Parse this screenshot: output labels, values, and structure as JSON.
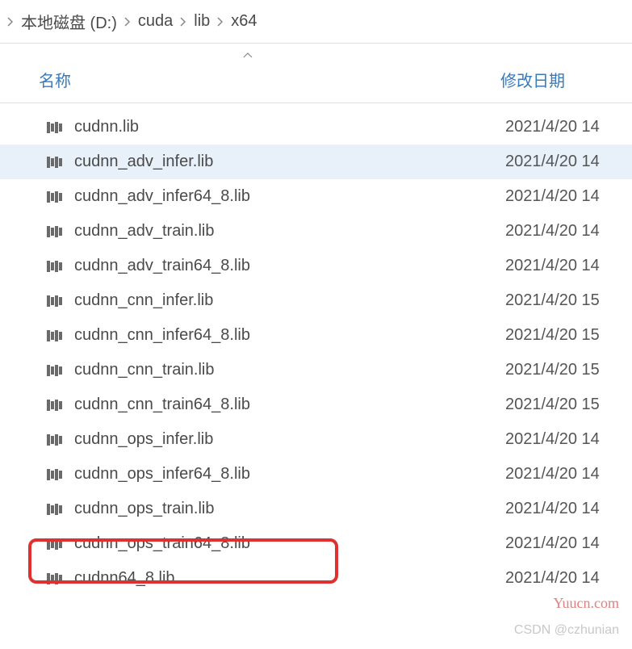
{
  "breadcrumb": {
    "items": [
      "本地磁盘 (D:)",
      "cuda",
      "lib",
      "x64"
    ]
  },
  "columns": {
    "name": "名称",
    "date": "修改日期"
  },
  "files": [
    {
      "name": "cudnn.lib",
      "date": "2021/4/20 14",
      "selected": false
    },
    {
      "name": "cudnn_adv_infer.lib",
      "date": "2021/4/20 14",
      "selected": true
    },
    {
      "name": "cudnn_adv_infer64_8.lib",
      "date": "2021/4/20 14",
      "selected": false
    },
    {
      "name": "cudnn_adv_train.lib",
      "date": "2021/4/20 14",
      "selected": false
    },
    {
      "name": "cudnn_adv_train64_8.lib",
      "date": "2021/4/20 14",
      "selected": false
    },
    {
      "name": "cudnn_cnn_infer.lib",
      "date": "2021/4/20 15",
      "selected": false
    },
    {
      "name": "cudnn_cnn_infer64_8.lib",
      "date": "2021/4/20 15",
      "selected": false
    },
    {
      "name": "cudnn_cnn_train.lib",
      "date": "2021/4/20 15",
      "selected": false
    },
    {
      "name": "cudnn_cnn_train64_8.lib",
      "date": "2021/4/20 15",
      "selected": false
    },
    {
      "name": "cudnn_ops_infer.lib",
      "date": "2021/4/20 14",
      "selected": false
    },
    {
      "name": "cudnn_ops_infer64_8.lib",
      "date": "2021/4/20 14",
      "selected": false
    },
    {
      "name": "cudnn_ops_train.lib",
      "date": "2021/4/20 14",
      "selected": false
    },
    {
      "name": "cudnn_ops_train64_8.lib",
      "date": "2021/4/20 14",
      "selected": false
    },
    {
      "name": "cudnn64_8.lib",
      "date": "2021/4/20 14",
      "selected": false
    }
  ],
  "watermarks": {
    "site": "Yuucn.com",
    "author": "CSDN @czhunian"
  }
}
